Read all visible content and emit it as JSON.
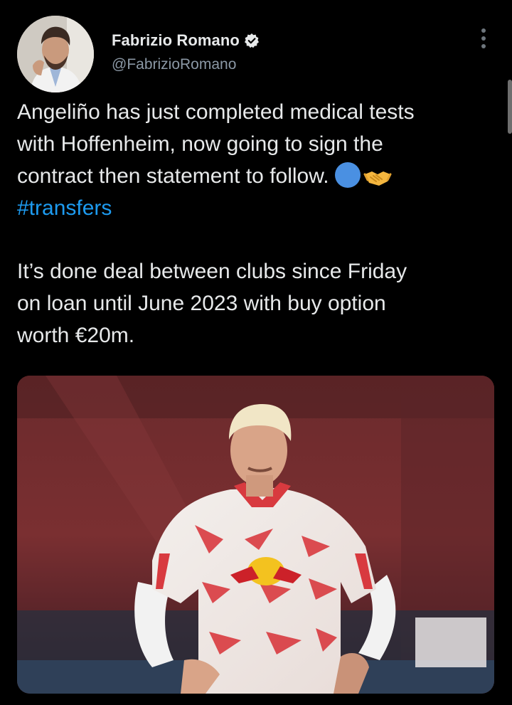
{
  "author": {
    "display_name": "Fabrizio Romano",
    "handle": "@FabrizioRomano",
    "verified": true,
    "avatar_icon": "profile-photo"
  },
  "tweet": {
    "line1": "Angeliño has just completed medical tests",
    "line2": "with Hoffenheim, now going to sign the",
    "line3": "contract then statement to follow.",
    "emojis": [
      "blue-circle",
      "handshake"
    ],
    "hashtag": "#transfers",
    "para2_line1": "It’s done deal between clubs since Friday",
    "para2_line2": "on loan until June 2023 with buy option",
    "para2_line3": "worth €20m."
  },
  "media": {
    "description_icon": "photo-player"
  },
  "colors": {
    "background": "#000000",
    "text": "#e7e9ea",
    "secondary": "#8b98a5",
    "link": "#1d9bf0"
  }
}
